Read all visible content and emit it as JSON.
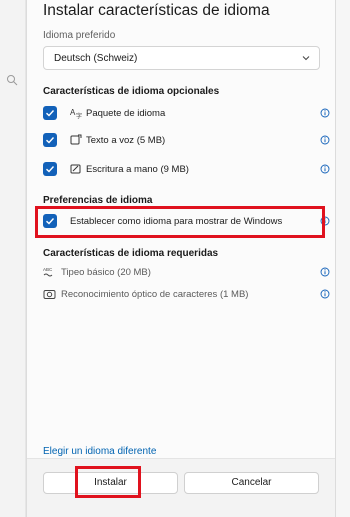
{
  "dialog": {
    "title": "Instalar características de idioma",
    "preferred_label": "Idioma preferido",
    "preferred_value": "Deutsch (Schweiz)"
  },
  "optional": {
    "heading": "Características de idioma opcionales",
    "items": [
      {
        "label": "Paquete de idioma",
        "checked": true,
        "icon": "language-pack-icon"
      },
      {
        "label": "Texto a voz (5 MB)",
        "checked": true,
        "icon": "text-to-speech-icon"
      },
      {
        "label": "Escritura a mano (9 MB)",
        "checked": true,
        "icon": "handwriting-icon"
      }
    ]
  },
  "preferences": {
    "heading": "Preferencias de idioma",
    "display_label": "Establecer como idioma para mostrar de Windows",
    "display_checked": true
  },
  "required": {
    "heading": "Características de idioma requeridas",
    "items": [
      {
        "label": "Tipeo básico (20 MB)",
        "icon": "basic-typing-icon"
      },
      {
        "label": "Reconocimiento óptico de caracteres (1 MB)",
        "icon": "ocr-icon"
      }
    ]
  },
  "footer": {
    "choose_other": "Elegir un idioma diferente",
    "install": "Instalar",
    "cancel": "Cancelar"
  },
  "colors": {
    "accent": "#1261b9",
    "highlight": "#e0121e",
    "link": "#0063b1"
  }
}
